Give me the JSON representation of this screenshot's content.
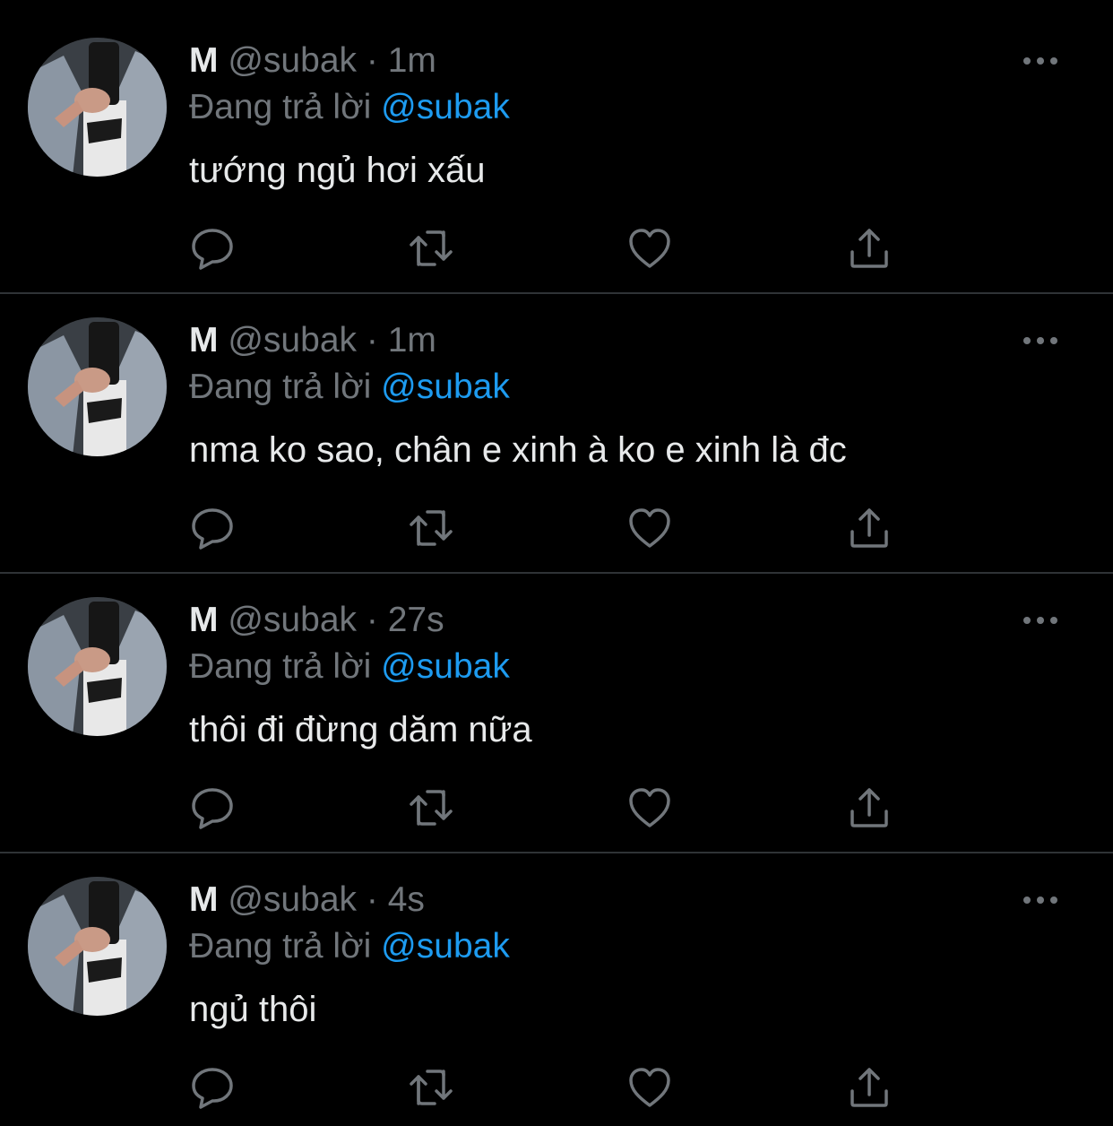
{
  "colors": {
    "background": "#000000",
    "text_primary": "#e7e9ea",
    "text_secondary": "#71767b",
    "accent": "#1d9bf0",
    "divider": "#2f3336"
  },
  "icons": {
    "reply": "reply-icon",
    "retweet": "retweet-icon",
    "like": "heart-icon",
    "share": "share-icon",
    "more": "more-icon"
  },
  "tweets": [
    {
      "name": "M",
      "handle": "@subak",
      "separator": "·",
      "time": "1m",
      "reply_prefix": "Đang trả lời",
      "reply_to": "@subak",
      "text": "tướng ngủ hơi xấu"
    },
    {
      "name": "M",
      "handle": "@subak",
      "separator": "·",
      "time": "1m",
      "reply_prefix": "Đang trả lời",
      "reply_to": "@subak",
      "text": "nma ko sao, chân e xinh à ko e xinh là đc"
    },
    {
      "name": "M",
      "handle": "@subak",
      "separator": "·",
      "time": "27s",
      "reply_prefix": "Đang trả lời",
      "reply_to": "@subak",
      "text": "thôi đi đừng dăm nữa"
    },
    {
      "name": "M",
      "handle": "@subak",
      "separator": "·",
      "time": "4s",
      "reply_prefix": "Đang trả lời",
      "reply_to": "@subak",
      "text": "ngủ thôi"
    }
  ]
}
